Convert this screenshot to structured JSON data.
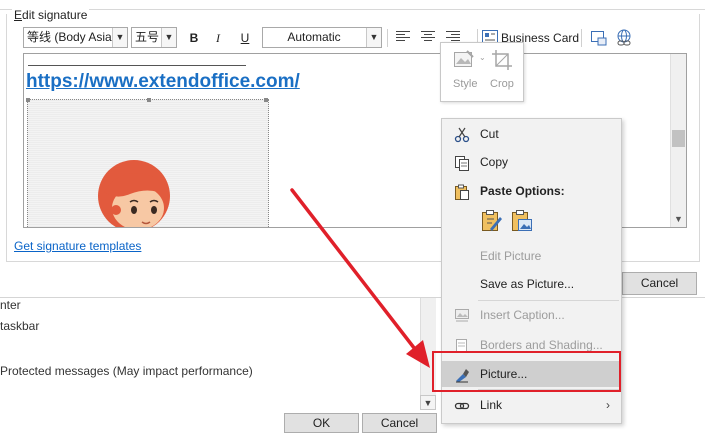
{
  "dialog": {
    "group_title_prefix": "E",
    "group_title_rest": "dit signature",
    "templates_link": "Get signature templates",
    "cancel_label": "Cancel"
  },
  "toolbar": {
    "font_name": "等线 (Body Asian",
    "font_size": "五号",
    "bold": "B",
    "italic": "I",
    "underline": "U",
    "color": "Automatic",
    "business_card": "Business Card"
  },
  "editor": {
    "link_text": "https://www.extendoffice.com/"
  },
  "mini_toolbar": {
    "style_label": "Style",
    "crop_label": "Crop"
  },
  "context_menu": {
    "cut": "Cut",
    "copy": "Copy",
    "paste_options": "Paste Options:",
    "edit_picture": "Edit Picture",
    "save_as_picture": "Save as Picture...",
    "insert_caption": "Insert Caption...",
    "borders_shading": "Borders and Shading...",
    "picture": "Picture...",
    "link": "Link"
  },
  "background": {
    "line1": "nter",
    "line2": "taskbar",
    "line3": "Protected messages (May impact performance)",
    "ok_label": "OK",
    "cancel_label": "Cancel"
  },
  "colors": {
    "highlight_box": "#e0202a",
    "link_blue": "#1a6fc4",
    "menu_highlight": "#cfcfcf"
  }
}
